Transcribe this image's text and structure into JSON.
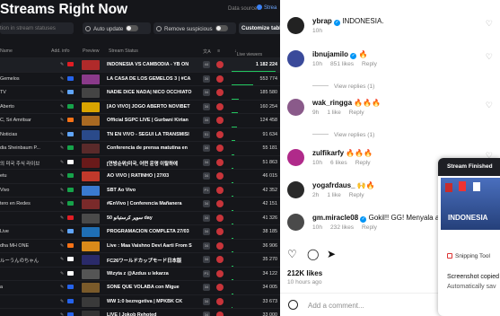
{
  "left_app": {
    "title": "Streams Right Now",
    "data_source_label": "Data source:",
    "data_source_button": "Strea",
    "search_placeholder": "tion in stream statuses",
    "auto_update_label": "Auto update",
    "remove_suspicious_label": "Remove suspicious",
    "customize_label": "Customize table",
    "columns": [
      "Name",
      "Add. info",
      "Preview",
      "Stream Status",
      "",
      "",
      "Live viewers"
    ],
    "rows": [
      {
        "name": "",
        "status": "INDONESIA VS CAMBODIA - YB ON",
        "badge": "44",
        "viewers": "1 182 224",
        "flag_color": "#e11d24",
        "thumb_color": "#b02a2a",
        "fill": 0.95
      },
      {
        "name": "Gemelos",
        "status": "LA CASA DE LOS GEMELOS 3 | #CA",
        "badge": "34",
        "viewers": "553 774",
        "flag_color": "#2563eb",
        "thumb_color": "#8a3a8a",
        "fill": 0.46
      },
      {
        "name": "TV",
        "status": "NADIE DICE NADA| NICO OCCHIATO",
        "badge": "34",
        "viewers": "185 580",
        "flag_color": "#60a5fa",
        "thumb_color": "#444",
        "fill": 0.16
      },
      {
        "name": "Aberto",
        "status": "[AO VIVO] JOGO ABERTO NOVIBET",
        "badge": "34",
        "viewers": "160 254",
        "flag_color": "#16a34a",
        "thumb_color": "#d9a400",
        "fill": 0.14
      },
      {
        "name": "C, Sri Amritsar",
        "status": "Official SGPC LIVE | Gurbani Kirtan",
        "badge": "34",
        "viewers": "124 458",
        "flag_color": "#f97316",
        "thumb_color": "#aa6a22",
        "fill": 0.11
      },
      {
        "name": "Noticias",
        "status": "TN EN VIVO - SEGUÍ LA TRANSMISI",
        "badge": "51",
        "viewers": "91 634",
        "flag_color": "#60a5fa",
        "thumb_color": "#2a4a8a",
        "fill": 0.08
      },
      {
        "name": "dia Sheinbaum P...",
        "status": "Conferencia de prensa matutina en",
        "badge": "34",
        "viewers": "55 181",
        "flag_color": "#16a34a",
        "thumb_color": "#5a2a2a",
        "fill": 0.05
      },
      {
        "name": "의 미국 주식 라이브",
        "status": "[연방순위]미국, 어떤 운명 이탈하에",
        "badge": "34",
        "viewers": "51 863",
        "flag_color": "#fff",
        "thumb_color": "#6a1a1a",
        "fill": 0.045
      },
      {
        "name": "etu",
        "status": "AO VIVO | RATINHO | 27/03",
        "badge": "34",
        "viewers": "46 015",
        "flag_color": "#16a34a",
        "thumb_color": "#c0392b",
        "fill": 0.04
      },
      {
        "name": "Vivo",
        "status": "SBT Ao Vivo",
        "badge": "P1",
        "viewers": "42 352",
        "flag_color": "#16a34a",
        "thumb_color": "#3a7ad0",
        "fill": 0.037
      },
      {
        "name": "tero en Redes",
        "status": "#EnVivo | Conferencia Mañanera",
        "badge": "34",
        "viewers": "42 151",
        "flag_color": "#16a34a",
        "thumb_color": "#7a2a2a",
        "fill": 0.036
      },
      {
        "name": "",
        "status": "سوپر كرستيانو 50 day",
        "badge": "34",
        "viewers": "41 326",
        "flag_color": "#e11d24",
        "thumb_color": "#4a4a4a",
        "fill": 0.035
      },
      {
        "name": "Live",
        "status": "PROGRAMACIÓN COMPLETA 27/03",
        "badge": "34",
        "viewers": "38 185",
        "flag_color": "#60a5fa",
        "thumb_color": "#1f6fb5",
        "fill": 0.033
      },
      {
        "name": "dha MH ONE",
        "status": "Live : Maa Vaishno Devi Aarti From S",
        "badge": "34",
        "viewers": "36 906",
        "flag_color": "#f97316",
        "thumb_color": "#d98a1a",
        "fill": 0.032
      },
      {
        "name": "ルーうんのちゃん",
        "status": "FC26ワールドカップモード日本版",
        "badge": "34",
        "viewers": "35 270",
        "flag_color": "#fff",
        "thumb_color": "#2a2a6a",
        "fill": 0.03
      },
      {
        "name": "",
        "status": "Wizyta z @Azdus u lekarza",
        "badge": "P1",
        "viewers": "34 122",
        "flag_color": "#fff",
        "thumb_color": "#555",
        "fill": 0.029
      },
      {
        "name": "a",
        "status": "SOÑÉ QUE VOLABA con Migue",
        "badge": "34",
        "viewers": "34 005",
        "flag_color": "#2563eb",
        "thumb_color": "#7a5a2a",
        "fill": 0.029
      },
      {
        "name": "",
        "status": "WW 1:0 bezregetiva | MPKBK CK",
        "badge": "34",
        "viewers": "33 673",
        "flag_color": "#2563eb",
        "thumb_color": "#3a3a3a",
        "fill": 0.028
      },
      {
        "name": "",
        "status": "LIVE | Jokob Rehoted",
        "badge": "34",
        "viewers": "33 000",
        "flag_color": "#2563eb",
        "thumb_color": "#333",
        "fill": 0.028
      }
    ]
  },
  "instagram": {
    "comments": [
      {
        "user": "ybrap",
        "verified": true,
        "text": "INDONESIA.",
        "time": "10h",
        "likes": "",
        "reply": "",
        "view_replies": "",
        "avatar_color": "#222"
      },
      {
        "user": "ibnujamilo",
        "verified": true,
        "text": "🔥",
        "time": "10h",
        "likes": "851 likes",
        "reply": "Reply",
        "view_replies": "View replies (1)",
        "avatar_color": "#3a4a9a"
      },
      {
        "user": "wak_ringga",
        "verified": false,
        "text": "🔥🔥🔥",
        "time": "9h",
        "likes": "1 like",
        "reply": "Reply",
        "view_replies": "View replies (1)",
        "avatar_color": "#8a5a8a"
      },
      {
        "user": "zulfikarfy",
        "verified": false,
        "text": "🔥🔥🔥",
        "time": "10h",
        "likes": "6 likes",
        "reply": "Reply",
        "view_replies": "",
        "avatar_color": "#b02a8a"
      },
      {
        "user": "yogafrdaus_",
        "verified": false,
        "text": "🙌🔥",
        "time": "2h",
        "likes": "1 like",
        "reply": "Reply",
        "view_replies": "",
        "avatar_color": "#2a2a2a"
      },
      {
        "user": "gm.miracle08",
        "verified": true,
        "text": "Gokil!! GG! Menyala aba",
        "time": "10h",
        "likes": "232 likes",
        "reply": "Reply",
        "view_replies": "",
        "avatar_color": "#4a4a4a"
      }
    ],
    "likes_total": "212K likes",
    "posted_time": "10 hours ago",
    "add_comment_placeholder": "Add a comment..."
  },
  "notification": {
    "header": "Stream Finished",
    "image_title": "INDONESIA",
    "app": "Snipping Tool",
    "line1": "Screenshot copied",
    "line2": "Automatically sav"
  }
}
